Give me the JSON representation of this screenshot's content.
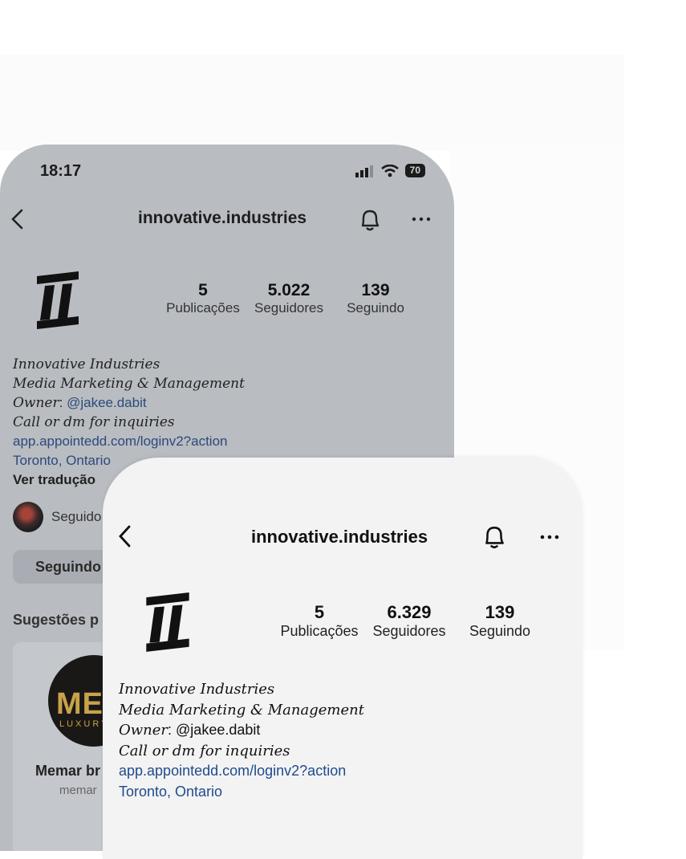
{
  "back": {
    "status": {
      "time": "18:17",
      "battery": "70"
    },
    "header": {
      "username": "innovative.industries"
    },
    "stats": [
      {
        "value": "5",
        "label": "Publicações"
      },
      {
        "value": "5.022",
        "label": "Seguidores"
      },
      {
        "value": "139",
        "label": "Seguindo"
      }
    ],
    "bio": {
      "name": "Innovative Industries",
      "tagline": "Media Marketing & Management",
      "owner_prefix": "Owner",
      "owner_handle": "@jakee.dabit",
      "cta": "Call or dm for inquiries",
      "link": "app.appointedd.com/loginv2?action",
      "location": "Toronto, Ontario",
      "translate": "Ver tradução"
    },
    "followed_by": "Seguido",
    "following_button": "Seguindo",
    "suggestions_title": "Sugestões p",
    "suggestion": {
      "name": "Memar br",
      "handle": "memar",
      "logo_text": "MEM",
      "logo_sub": "LUXURY"
    }
  },
  "front": {
    "header": {
      "username": "innovative.industries"
    },
    "stats": [
      {
        "value": "5",
        "label": "Publicações"
      },
      {
        "value": "6.329",
        "label": "Seguidores"
      },
      {
        "value": "139",
        "label": "Seguindo"
      }
    ],
    "bio": {
      "name": "Innovative Industries",
      "tagline": "Media Marketing & Management",
      "owner_prefix": "Owner",
      "owner_handle": "@jakee.dabit",
      "cta": "Call or dm for inquiries",
      "link": "app.appointedd.com/loginv2?action",
      "location": "Toronto, Ontario"
    }
  }
}
